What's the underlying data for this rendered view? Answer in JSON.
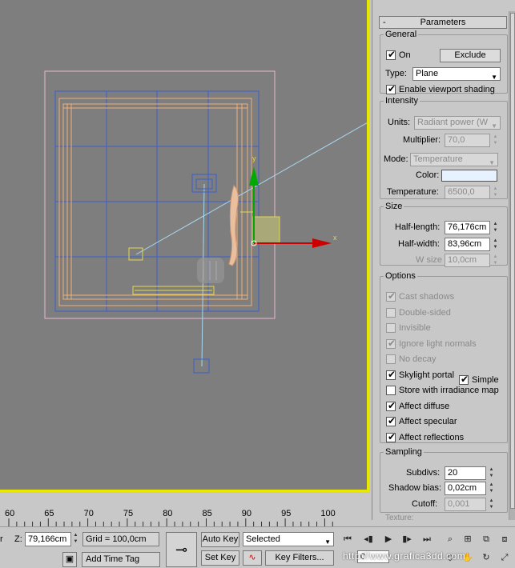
{
  "viewport": {
    "axis_x": "x",
    "axis_y": "y"
  },
  "panel": {
    "rollout_title": "Parameters",
    "rollout_toggle": "-",
    "general": {
      "legend": "General",
      "on_label": "On",
      "on_checked": true,
      "exclude_label": "Exclude",
      "type_label": "Type:",
      "type_value": "Plane",
      "viewport_shading_label": "Enable viewport shading",
      "viewport_shading_checked": true
    },
    "intensity": {
      "legend": "Intensity",
      "units_label": "Units:",
      "units_value": "Radiant power (W",
      "multiplier_label": "Multiplier:",
      "multiplier_value": "70,0",
      "mode_label": "Mode:",
      "mode_value": "Temperature",
      "color_label": "Color:",
      "color_hex": "#e6f2ff",
      "temperature_label": "Temperature:",
      "temperature_value": "6500,0"
    },
    "size": {
      "legend": "Size",
      "half_length_label": "Half-length:",
      "half_length_value": "76,176cm",
      "half_width_label": "Half-width:",
      "half_width_value": "83,96cm",
      "w_size_label": "W size",
      "w_size_value": "10,0cm"
    },
    "options": {
      "legend": "Options",
      "items": [
        {
          "label": "Cast shadows",
          "checked": true,
          "enabled": false
        },
        {
          "label": "Double-sided",
          "checked": false,
          "enabled": false
        },
        {
          "label": "Invisible",
          "checked": false,
          "enabled": false
        },
        {
          "label": "Ignore light normals",
          "checked": true,
          "enabled": false
        },
        {
          "label": "No decay",
          "checked": false,
          "enabled": false
        },
        {
          "label": "Skylight portal",
          "checked": true,
          "enabled": true
        },
        {
          "label": "Store with irradiance map",
          "checked": false,
          "enabled": true
        },
        {
          "label": "Affect diffuse",
          "checked": true,
          "enabled": true
        },
        {
          "label": "Affect specular",
          "checked": true,
          "enabled": true
        },
        {
          "label": "Affect reflections",
          "checked": true,
          "enabled": true
        }
      ],
      "simple_label": "Simple",
      "simple_checked": true
    },
    "sampling": {
      "legend": "Sampling",
      "subdivs_label": "Subdivs:",
      "subdivs_value": "20",
      "shadow_bias_label": "Shadow bias:",
      "shadow_bias_value": "0,02cm",
      "cutoff_label": "Cutoff:",
      "cutoff_value": "0,001"
    },
    "texture_legend": "Texture:"
  },
  "ruler": {
    "ticks": [
      "60",
      "65",
      "70",
      "75",
      "80",
      "85",
      "90",
      "95",
      "100"
    ]
  },
  "statusbar": {
    "z_label": "Z:",
    "z_value": "79,166cm",
    "grid_label": "Grid = 100,0cm",
    "add_time_tag": "Add Time Tag",
    "auto_key": "Auto Key",
    "selected_value": "Selected",
    "set_key": "Set Key",
    "key_filters": "Key Filters...",
    "frame_value": "0"
  },
  "watermark": "http://www.grafica3dd.com",
  "colors": {
    "viewport_bg": "#7e7e7e",
    "active_border": "#e8e800",
    "blue_wire": "#3a5fcd",
    "orange_wire": "#f0b07a",
    "pink_wire": "#e8b8d0"
  }
}
